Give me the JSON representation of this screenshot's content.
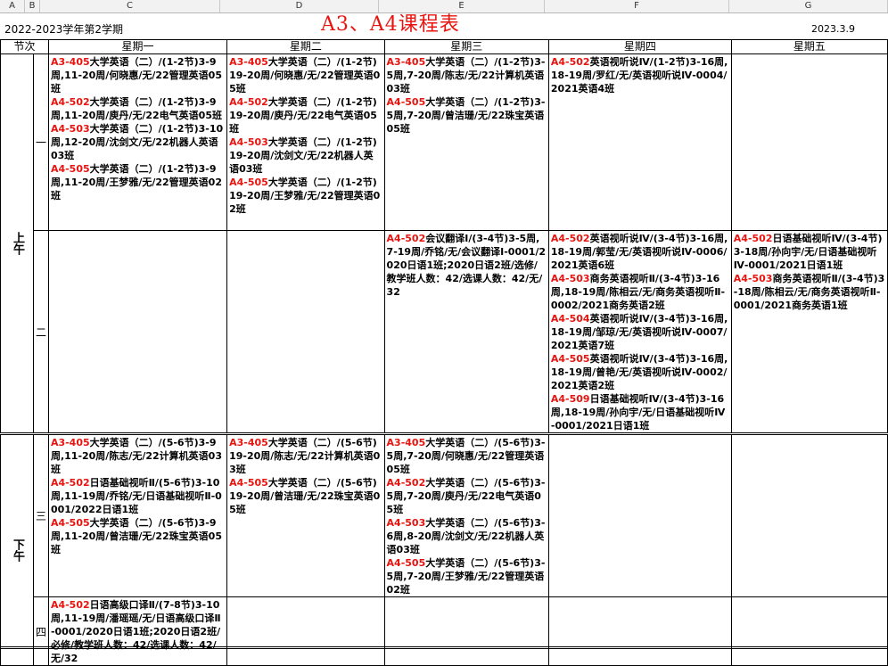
{
  "column_headers": [
    "A",
    "B",
    "C",
    "D",
    "E",
    "F",
    "G"
  ],
  "semester": "2022-2023学年第2学期",
  "title": "A3、A4课程表",
  "date": "2023.3.9",
  "table": {
    "period_header": "节次",
    "days": [
      "星期一",
      "星期二",
      "星期三",
      "星期四",
      "星期五"
    ],
    "sections": [
      {
        "label": "上午",
        "rows": [
          {
            "period": "一",
            "cells": [
              [
                {
                  "room": "A3-405",
                  "text": "大学英语（二）/(1-2节)3-9周,11-20周/何晓惠/无/22管理英语05班"
                },
                {
                  "room": "A4-502",
                  "text": "大学英语（二）/(1-2节)3-9周,11-20周/庾丹/无/22电气英语05班"
                },
                {
                  "room": "A4-503",
                  "text": "大学英语（二）/(1-2节)3-10周,12-20周/沈剑文/无/22机器人英语03班"
                },
                {
                  "room": "A4-505",
                  "text": "大学英语（二）/(1-2节)3-9周,11-20周/王梦雅/无/22管理英语02班"
                }
              ],
              [
                {
                  "room": "A3-405",
                  "text": "大学英语（二）/(1-2节)19-20周/何晓惠/无/22管理英语05班"
                },
                {
                  "room": "A4-502",
                  "text": "大学英语（二）/(1-2节)19-20周/庾丹/无/22电气英语05班"
                },
                {
                  "room": "A4-503",
                  "text": "大学英语（二）/(1-2节)19-20周/沈剑文/无/22机器人英语03班"
                },
                {
                  "room": "A4-505",
                  "text": "大学英语（二）/(1-2节)19-20周/王梦雅/无/22管理英语02班"
                }
              ],
              [
                {
                  "room": "A3-405",
                  "text": "大学英语（二）/(1-2节)3-5周,7-20周/陈志/无/22计算机英语03班"
                },
                {
                  "room": "A4-505",
                  "text": "大学英语（二）/(1-2节)3-5周,7-20周/曾洁珊/无/22珠宝英语05班"
                }
              ],
              [
                {
                  "room": "A4-502",
                  "text": "英语视听说Ⅳ/(1-2节)3-16周,18-19周/罗红/无/英语视听说Ⅳ-0004/2021英语4班"
                }
              ],
              []
            ]
          },
          {
            "period": "二",
            "cells": [
              [],
              [],
              [
                {
                  "room": "A4-502",
                  "text": "会议翻译Ⅰ/(3-4节)3-5周,7-19周/乔铭/无/会议翻译Ⅰ-0001/2020日语1班;2020日语2班/选修/教学班人数：42/选课人数：42/无/32"
                }
              ],
              [
                {
                  "room": "A4-502",
                  "text": "英语视听说Ⅳ/(3-4节)3-16周,18-19周/郭莹/无/英语视听说Ⅳ-0006/2021英语6班"
                },
                {
                  "room": "A4-503",
                  "text": "商务英语视听Ⅱ/(3-4节)3-16周,18-19周/陈相云/无/商务英语视听Ⅱ-0002/2021商务英语2班"
                },
                {
                  "room": "A4-504",
                  "text": "英语视听说Ⅳ/(3-4节)3-16周,18-19周/邹琼/无/英语视听说Ⅳ-0007/2021英语7班"
                },
                {
                  "room": "A4-505",
                  "text": "英语视听说Ⅳ/(3-4节)3-16周,18-19周/曾艳/无/英语视听说Ⅳ-0002/2021英语2班"
                },
                {
                  "room": "A4-509",
                  "text": "日语基础视听Ⅳ/(3-4节)3-16周,18-19周/孙向宇/无/日语基础视听Ⅳ-0001/2021日语1班"
                }
              ],
              [
                {
                  "room": "A4-502",
                  "text": "日语基础视听Ⅳ/(3-4节)3-18周/孙向宇/无/日语基础视听Ⅳ-0001/2021日语1班"
                },
                {
                  "room": "A4-503",
                  "text": "商务英语视听Ⅱ/(3-4节)3-18周/陈相云/无/商务英语视听Ⅱ-0001/2021商务英语1班"
                }
              ]
            ]
          }
        ]
      },
      {
        "label": "下午",
        "rows": [
          {
            "period": "三",
            "cells": [
              [
                {
                  "room": "A3-405",
                  "text": "大学英语（二）/(5-6节)3-9周,11-20周/陈志/无/22计算机英语03班"
                },
                {
                  "room": "A4-502",
                  "text": "日语基础视听Ⅱ/(5-6节)3-10周,11-19周/乔铭/无/日语基础视听Ⅱ-0001/2022日语1班"
                },
                {
                  "room": "A4-505",
                  "text": "大学英语（二）/(5-6节)3-9周,11-20周/曾洁珊/无/22珠宝英语05班"
                }
              ],
              [
                {
                  "room": "A3-405",
                  "text": "大学英语（二）/(5-6节)19-20周/陈志/无/22计算机英语03班"
                },
                {
                  "room": "A4-505",
                  "text": "大学英语（二）/(5-6节)19-20周/曾洁珊/无/22珠宝英语05班"
                }
              ],
              [
                {
                  "room": "A3-405",
                  "text": "大学英语（二）/(5-6节)3-5周,7-20周/何晓惠/无/22管理英语05班"
                },
                {
                  "room": "A4-502",
                  "text": "大学英语（二）/(5-6节)3-5周,7-20周/庾丹/无/22电气英语05班"
                },
                {
                  "room": "A4-503",
                  "text": "大学英语（二）/(5-6节)3-6周,8-20周/沈剑文/无/22机器人英语03班"
                },
                {
                  "room": "A4-505",
                  "text": "大学英语（二）/(5-6节)3-5周,7-20周/王梦雅/无/22管理英语02班"
                }
              ],
              [],
              []
            ]
          },
          {
            "period": "四",
            "cells": [
              [
                {
                  "room": "A4-502",
                  "text": "日语高级口译Ⅱ/(7-8节)3-10周,11-19周/潘瑶瑶/无/日语高级口译Ⅱ-0001/2020日语1班;2020日语2班/必修/教学班人数：42/选课人数：42/无/32"
                }
              ],
              [],
              [],
              [],
              []
            ]
          }
        ]
      }
    ]
  }
}
